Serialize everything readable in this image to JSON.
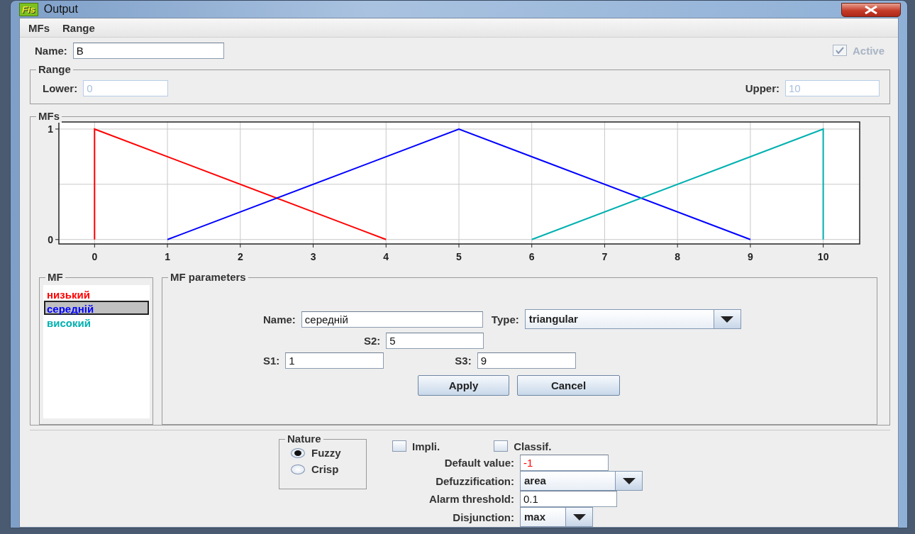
{
  "window": {
    "icon_text": "Fis",
    "title": "Output"
  },
  "menu": [
    "MFs",
    "Range"
  ],
  "name": {
    "label": "Name:",
    "value": "B"
  },
  "active": {
    "label": "Active",
    "checked": true,
    "disabled": true
  },
  "range": {
    "title": "Range",
    "lower": {
      "label": "Lower:",
      "value": "0",
      "disabled": true
    },
    "upper": {
      "label": "Upper:",
      "value": "10",
      "disabled": true
    }
  },
  "mfs": {
    "title": "MFs",
    "chart_data": {
      "type": "line",
      "xlim": [
        -0.49,
        10.5
      ],
      "ylim": [
        -0.04,
        1.064
      ],
      "xticks": [
        0,
        1,
        2,
        3,
        4,
        5,
        6,
        7,
        8,
        9,
        10
      ],
      "yticks": [
        0,
        1
      ],
      "grid": true,
      "series": [
        {
          "color": "#ff0000",
          "x": [
            0,
            0,
            4
          ],
          "values": [
            0,
            1,
            0
          ]
        },
        {
          "color": "#0000ff",
          "x": [
            1,
            5,
            9
          ],
          "values": [
            0,
            1,
            0
          ]
        },
        {
          "color": "#00b0b0",
          "x": [
            6,
            10,
            10
          ],
          "values": [
            0,
            1,
            0
          ]
        }
      ]
    }
  },
  "mf_list": {
    "title": "MF",
    "items": [
      {
        "label": "низький",
        "color": "#ff0000",
        "selected": false
      },
      {
        "label": "середній",
        "color": "#0000ff",
        "selected": true
      },
      {
        "label": "високий",
        "color": "#00b0b0",
        "selected": false
      }
    ]
  },
  "mf_parameters": {
    "title": "MF parameters",
    "name": {
      "label": "Name:",
      "value": "середній"
    },
    "type": {
      "label": "Type:",
      "value": "triangular"
    },
    "params": [
      {
        "label": "S2:",
        "value": "5"
      },
      {
        "label": "S1:",
        "value": "1"
      },
      {
        "label": "S3:",
        "value": "9"
      }
    ],
    "buttons": [
      "Apply",
      "Cancel"
    ]
  },
  "nature": {
    "title": "Nature",
    "options": [
      {
        "label": "Fuzzy",
        "selected": true
      },
      {
        "label": "Crisp",
        "selected": false
      }
    ]
  },
  "impli": {
    "label": "Impli.",
    "checked": false
  },
  "classif": {
    "label": "Classif.",
    "checked": false
  },
  "default_value": {
    "label": "Default value:",
    "value": "-1"
  },
  "defuzzification": {
    "label": "Defuzzification:",
    "value": "area"
  },
  "alarm_threshold": {
    "label": "Alarm threshold:",
    "value": "0.1"
  },
  "disjunction": {
    "label": "Disjunction:",
    "value": "max"
  }
}
